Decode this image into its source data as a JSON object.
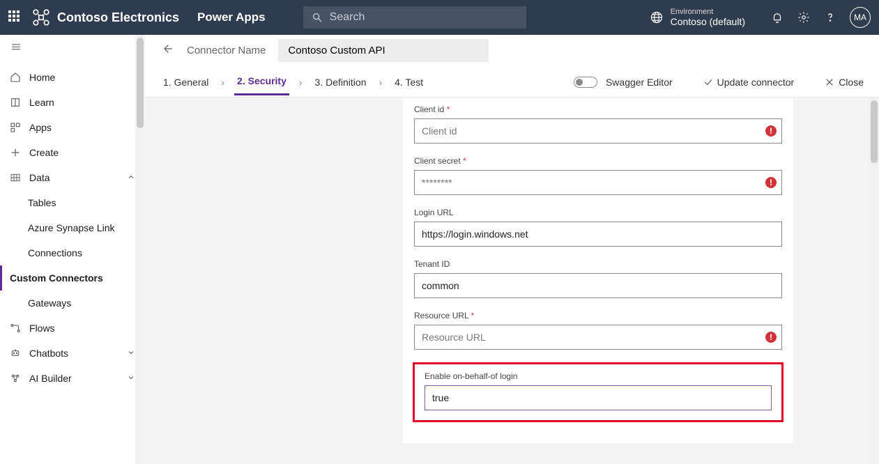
{
  "header": {
    "brand": "Contoso Electronics",
    "app": "Power Apps",
    "search_placeholder": "Search",
    "env_label": "Environment",
    "env_name": "Contoso (default)",
    "profile_initials": "MA"
  },
  "sidebar": {
    "items": [
      {
        "label": "Home"
      },
      {
        "label": "Learn"
      },
      {
        "label": "Apps"
      },
      {
        "label": "Create"
      },
      {
        "label": "Data",
        "expanded": true
      },
      {
        "label": "Tables",
        "sub": true
      },
      {
        "label": "Azure Synapse Link",
        "sub": true
      },
      {
        "label": "Connections",
        "sub": true
      },
      {
        "label": "Custom Connectors",
        "sub": true,
        "active": true
      },
      {
        "label": "Gateways",
        "sub": true
      },
      {
        "label": "Flows"
      },
      {
        "label": "Chatbots"
      },
      {
        "label": "AI Builder"
      }
    ]
  },
  "breadcrumb": {
    "label": "Connector Name",
    "value": "Contoso Custom API"
  },
  "wizard": {
    "steps": [
      "1. General",
      "2. Security",
      "3. Definition",
      "4. Test"
    ],
    "current_index": 1,
    "swagger": "Swagger Editor",
    "update": "Update connector",
    "close": "Close"
  },
  "form": {
    "client_id": {
      "label": "Client id",
      "placeholder": "Client id",
      "value": "",
      "required": true,
      "error": true
    },
    "client_secret": {
      "label": "Client secret",
      "placeholder": "********",
      "value": "",
      "required": true,
      "error": true
    },
    "login_url": {
      "label": "Login URL",
      "value": "https://login.windows.net",
      "required": false,
      "error": false
    },
    "tenant_id": {
      "label": "Tenant ID",
      "value": "common",
      "required": false,
      "error": false
    },
    "resource_url": {
      "label": "Resource URL",
      "placeholder": "Resource URL",
      "value": "",
      "required": true,
      "error": true
    },
    "obo": {
      "label": "Enable on-behalf-of login",
      "value": "true",
      "required": false,
      "error": false
    }
  }
}
